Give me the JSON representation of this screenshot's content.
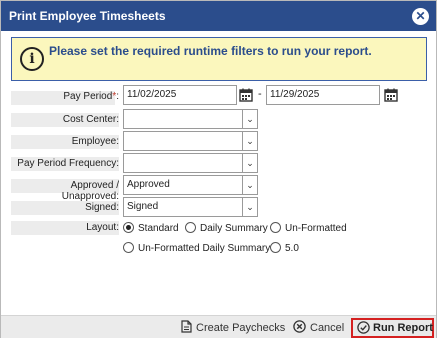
{
  "dialog": {
    "title": "Print Employee Timesheets",
    "close_glyph": "✕",
    "notice": "Please set the required runtime filters to run your report.",
    "info_glyph": "i"
  },
  "form": {
    "pay_period": {
      "label": "Pay Period",
      "required_mark": "*",
      "colon": ":",
      "start": "11/02/2025",
      "separator": "-",
      "end": "11/29/2025"
    },
    "cost_center": {
      "label": "Cost Center:",
      "value": ""
    },
    "employee": {
      "label": "Employee:",
      "value": ""
    },
    "pay_period_frequency": {
      "label": "Pay Period Frequency:",
      "value": ""
    },
    "approved": {
      "label": "Approved / Unapproved:",
      "value": "Approved"
    },
    "signed": {
      "label": "Signed:",
      "value": "Signed"
    },
    "layout": {
      "label": "Layout:",
      "options": [
        "Standard",
        "Daily Summary",
        "Un-Formatted",
        "Un-Formatted Daily Summary",
        "5.0"
      ],
      "selected": "Standard"
    }
  },
  "footer": {
    "create_paychecks": "Create Paychecks",
    "cancel": "Cancel",
    "run_report": "Run Report"
  },
  "icons": {
    "dropdown": "chevron-down-icon",
    "calendar": "calendar-icon",
    "document": "document-icon",
    "cancel": "cancel-circle-icon",
    "run": "checkmark-circle-icon"
  },
  "colors": {
    "titlebar": "#2b4d8c",
    "notice_bg": "#fbf7bd",
    "notice_text": "#2b4d8c",
    "required": "#c0392b",
    "highlight": "#d42020"
  }
}
